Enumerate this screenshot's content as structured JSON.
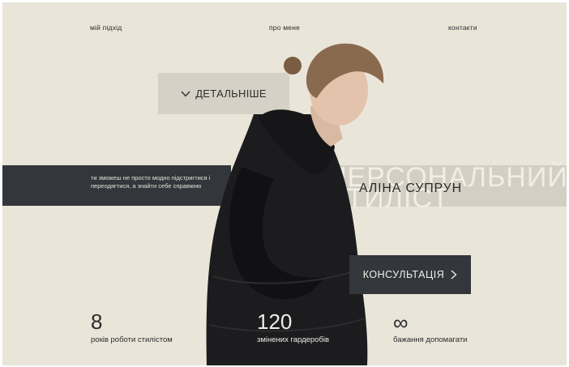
{
  "nav": {
    "items": [
      {
        "label": "мій підхід"
      },
      {
        "label": "про мене"
      },
      {
        "label": "контакти"
      }
    ]
  },
  "hero": {
    "more_label": "ДЕТАЛЬНІШЕ",
    "more_icon": "chevron-down-icon",
    "tagline": "ти зможеш не просто модно підстригтися і переодягтися, а знайти себе справжню",
    "ghost_line_1": "ПЕРСОНАЛЬНИЙ",
    "ghost_line_2": "СТИЛІСТ",
    "name": "АЛІНА СУПРУН",
    "consult_label": "КОНСУЛЬТАЦІЯ",
    "consult_icon": "chevron-right-icon"
  },
  "stats": [
    {
      "value": "8",
      "label": "років роботи стилістом"
    },
    {
      "value": "120",
      "label": "змінених гардеробів"
    },
    {
      "value": "∞",
      "label": "бажання допомагати"
    }
  ],
  "colors": {
    "background": "#e9e5d9",
    "dark_band": "#33363b",
    "light_band": "#d3cfc3",
    "button_light": "#d5d1c6",
    "text": "#2b2b2b"
  }
}
